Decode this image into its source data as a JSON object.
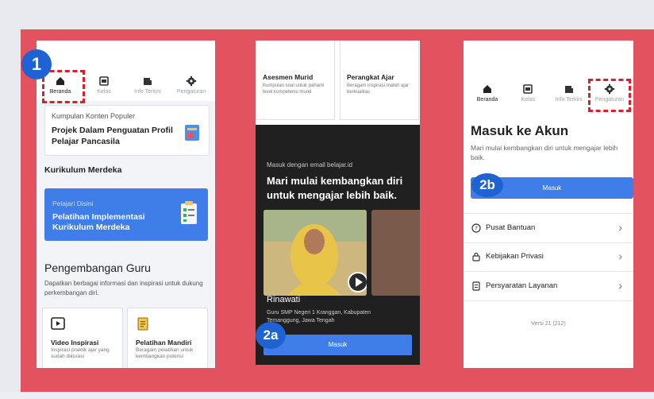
{
  "colors": {
    "background_red": "#e2535f",
    "blue_button": "#3f7ee8",
    "badge_blue": "#1f62d3",
    "highlight_red": "#d8202a",
    "dark_screen": "#202020"
  },
  "annotations": {
    "badge1": "1",
    "badge2a": "2a",
    "badge2b": "2b"
  },
  "nav": {
    "items": [
      {
        "label": "Beranda",
        "icon": "home-icon"
      },
      {
        "label": "Kelas",
        "icon": "class-icon"
      },
      {
        "label": "Info Terkini",
        "icon": "news-icon"
      },
      {
        "label": "Pengaturan",
        "icon": "gear-icon"
      }
    ]
  },
  "screen1": {
    "popular": {
      "subtitle": "Kumpulan Konten Populer",
      "title": "Projek Dalam Penguatan Profil Pelajar Pancasila"
    },
    "kurikulum_heading": "Kurikulum Merdeka",
    "blue_card": {
      "subtitle": "Pelajari Disini",
      "title": "Pelatihan Implementasi Kurikulum Merdeka"
    },
    "pengembangan": {
      "heading": "Pengembangan Guru",
      "description": "Dapatkan berbagai informasi dan inspirasi untuk dukung perkembangan diri."
    },
    "cards": [
      {
        "title": "Video Inspirasi",
        "description": "Inspirasi praktik ajar yang sudah dikurasi"
      },
      {
        "title": "Pelatihan Mandiri",
        "description": "Beragam pelatihan untuk kembangkan potensi"
      }
    ]
  },
  "screen2": {
    "cards": [
      {
        "title": "Asesmen Murid",
        "description": "Kumpulan soal untuk pahami level kompetensi murid"
      },
      {
        "title": "Perangkat Ajar",
        "description": "Beragam inspirasi materi ajar berkualitas"
      }
    ],
    "email_note": "Masuk dengan email belajar.id",
    "hero": "Mari mulai kembangkan diri untuk mengajar lebih baik.",
    "person_name": "Rinawati",
    "person_desc": "Guru SMP Negeri 1 Kranggan, Kabupaten Temanggung, Jawa Tengah",
    "button": "Masuk"
  },
  "screen3": {
    "title": "Masuk ke Akun",
    "description": "Mari mulai kembangkan diri untuk mengajar lebih baik.",
    "button": "Masuk",
    "menu": [
      {
        "label": "Pusat Bantuan",
        "icon": "help-icon"
      },
      {
        "label": "Kebijakan Privasi",
        "icon": "lock-icon"
      },
      {
        "label": "Persyaratan Layanan",
        "icon": "document-icon"
      }
    ],
    "version": "Versi 21 (212)"
  }
}
